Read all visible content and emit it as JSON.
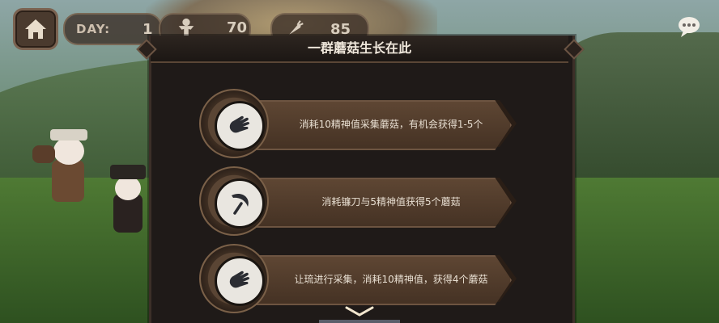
{
  "hud": {
    "day_label": "DAY:",
    "day_value": "1",
    "people_value": "70",
    "food_value": "85",
    "icons": [
      "home-icon",
      "person-icon",
      "carrot-icon",
      "chat-icon"
    ]
  },
  "panel": {
    "title": "一群蘑菇生长在此",
    "options": [
      {
        "icon": "hand-grab-icon",
        "text": "消耗10精神值采集蘑菇，有机会获得1-5个"
      },
      {
        "icon": "sickle-icon",
        "text": "消耗镰刀与5精神值获得5个蘑菇"
      },
      {
        "icon": "hand-grab-icon",
        "text": "让琉进行采集，消耗10精神值，获得4个蘑菇"
      }
    ],
    "more_icon": "chevron-down-icon"
  },
  "colors": {
    "panel_bg": "#1f1a18",
    "ribbon": "#533d2c",
    "text": "#e8dfd2",
    "accent": "#f0e8dc"
  }
}
